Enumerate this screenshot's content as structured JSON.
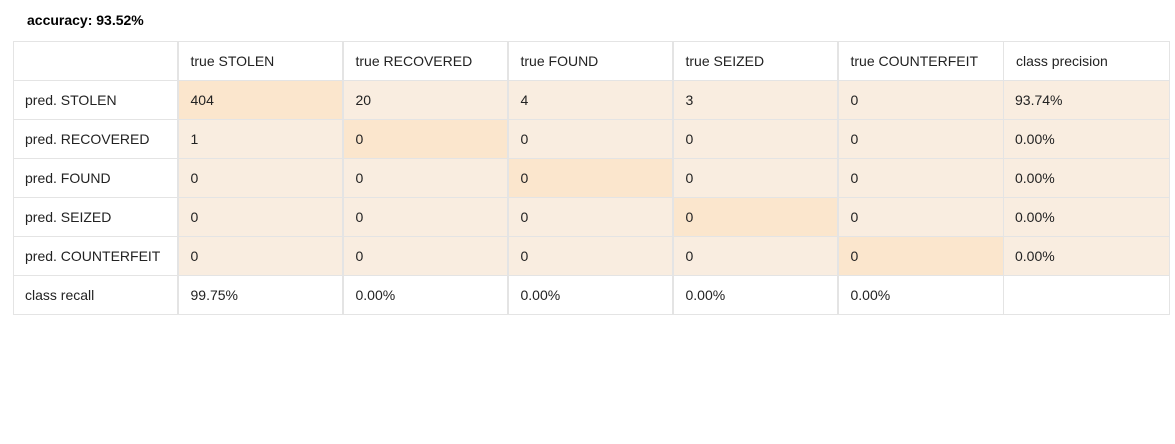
{
  "accuracy_label": "accuracy: 93.52%",
  "colors": {
    "cell_background": "#f9ede0",
    "diagonal_background": "#fbe6cd",
    "border": "#e4e4e4"
  },
  "headers": [
    "",
    "true STOLEN",
    "true RECOVERED",
    "true FOUND",
    "true SEIZED",
    "true COUNTERFEIT",
    "class precision"
  ],
  "rows": [
    {
      "label": "pred. STOLEN",
      "values": [
        "404",
        "20",
        "4",
        "3",
        "0"
      ],
      "precision": "93.74%"
    },
    {
      "label": "pred. RECOVERED",
      "values": [
        "1",
        "0",
        "0",
        "0",
        "0"
      ],
      "precision": "0.00%"
    },
    {
      "label": "pred. FOUND",
      "values": [
        "0",
        "0",
        "0",
        "0",
        "0"
      ],
      "precision": "0.00%"
    },
    {
      "label": "pred. SEIZED",
      "values": [
        "0",
        "0",
        "0",
        "0",
        "0"
      ],
      "precision": "0.00%"
    },
    {
      "label": "pred. COUNTERFEIT",
      "values": [
        "0",
        "0",
        "0",
        "0",
        "0"
      ],
      "precision": "0.00%"
    }
  ],
  "recall": {
    "label": "class recall",
    "values": [
      "99.75%",
      "0.00%",
      "0.00%",
      "0.00%",
      "0.00%"
    ],
    "precision": ""
  }
}
